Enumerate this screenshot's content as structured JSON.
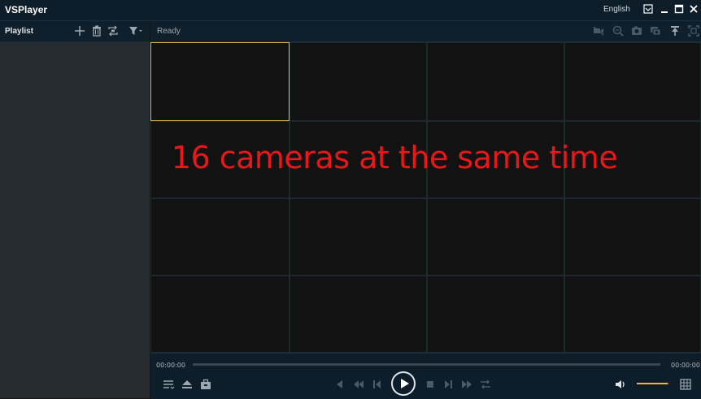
{
  "window": {
    "title": "VSPlayer",
    "language": "English",
    "buttons": [
      "menu-icon",
      "minimize-icon",
      "maximize-icon",
      "close-icon"
    ]
  },
  "playlist": {
    "title": "Playlist",
    "icons": [
      "add-icon",
      "delete-icon",
      "loop-icon",
      "filter-icon"
    ]
  },
  "toolbar": {
    "status": "Ready",
    "icons": [
      "record-icon",
      "zoom-icon",
      "snapshot-icon",
      "multi-snapshot-icon",
      "pin-icon",
      "fullscreen-icon"
    ]
  },
  "video": {
    "grid": "4x4",
    "selected_cell": 1,
    "overlay_text": "16 cameras at the same time",
    "overlay_color": "#e8181a",
    "selected_color": "#e5b93a"
  },
  "playback": {
    "time_current": "00:00:00",
    "time_total": "00:00:00",
    "progress": 0,
    "volume": 0.95
  },
  "colors": {
    "titlebar": "#0d1e2a",
    "sidebar": "#262b30",
    "video_bg": "#121212",
    "accent": "#e5b93a"
  }
}
